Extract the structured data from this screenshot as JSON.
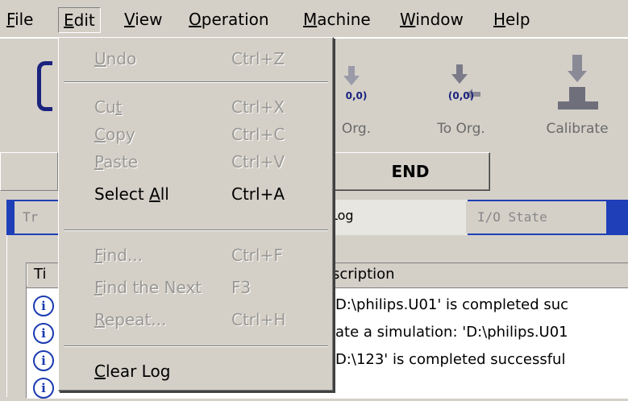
{
  "menubar": {
    "items": [
      {
        "label": "File",
        "mnemonic": "F",
        "rest": "ile"
      },
      {
        "label": "Edit",
        "mnemonic": "E",
        "rest": "dit"
      },
      {
        "label": "View",
        "mnemonic": "V",
        "rest": "iew"
      },
      {
        "label": "Operation",
        "mnemonic": "O",
        "rest": "peration"
      },
      {
        "label": "Machine",
        "mnemonic": "M",
        "rest": "achine"
      },
      {
        "label": "Window",
        "mnemonic": "W",
        "rest": "indow"
      },
      {
        "label": "Help",
        "mnemonic": "H",
        "rest": "elp"
      }
    ]
  },
  "toolbar": {
    "buttons": [
      {
        "label": "Org.",
        "coord": "0,0)",
        "icon": "arrow-down-icon"
      },
      {
        "label": "To Org.",
        "coord": "(0,0)",
        "icon": "to-origin-icon"
      },
      {
        "label": "Calibrate",
        "coord": "",
        "icon": "calibrate-icon"
      }
    ]
  },
  "status": {
    "end_label": "END"
  },
  "tabs": [
    {
      "label": "Tr"
    },
    {
      "label": "Log"
    },
    {
      "label": "I/O State"
    }
  ],
  "log": {
    "headers": [
      "Ti",
      "scription"
    ],
    "rows": [
      {
        "icon": "info-icon",
        "description": "'D:\\philips.U01' is completed suc"
      },
      {
        "icon": "info-icon",
        "description": "iate a simulation: 'D:\\philips.U01"
      },
      {
        "icon": "info-icon",
        "description": "'D:\\123' is completed successful"
      }
    ]
  },
  "edit_menu": {
    "items": [
      {
        "pre": "",
        "u": "U",
        "post": "ndo",
        "accel": "Ctrl+Z",
        "enabled": false
      },
      {
        "pre": "Cu",
        "u": "t",
        "post": "",
        "accel": "Ctrl+X",
        "enabled": false
      },
      {
        "pre": "",
        "u": "C",
        "post": "opy",
        "accel": "Ctrl+C",
        "enabled": false
      },
      {
        "pre": "",
        "u": "P",
        "post": "aste",
        "accel": "Ctrl+V",
        "enabled": false
      },
      {
        "pre": "Select ",
        "u": "A",
        "post": "ll",
        "accel": "Ctrl+A",
        "enabled": true
      },
      {
        "pre": "",
        "u": "F",
        "post": "ind...",
        "accel": "Ctrl+F",
        "enabled": false
      },
      {
        "pre": "",
        "u": "F",
        "post": "ind the Next",
        "accel": "F3",
        "enabled": false
      },
      {
        "pre": "",
        "u": "R",
        "post": "epeat...",
        "accel": "Ctrl+H",
        "enabled": false
      },
      {
        "pre": "",
        "u": "C",
        "post": "lear Log",
        "accel": "",
        "enabled": true
      }
    ]
  }
}
